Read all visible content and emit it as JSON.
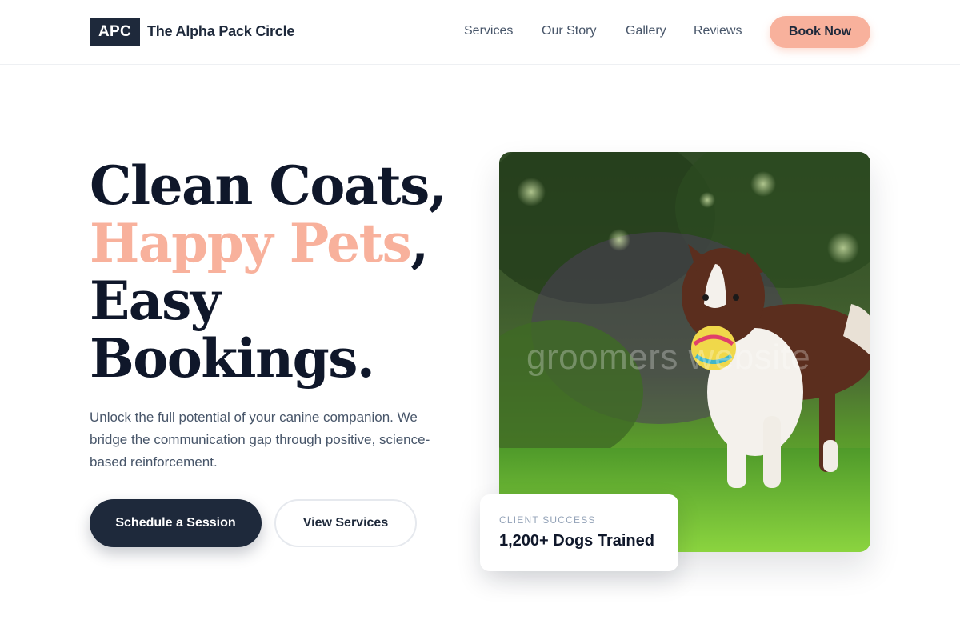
{
  "brand": {
    "badge": "APC",
    "name": "The Alpha Pack Circle"
  },
  "nav": {
    "items": [
      {
        "label": "Services"
      },
      {
        "label": "Our Story"
      },
      {
        "label": "Gallery"
      },
      {
        "label": "Reviews"
      }
    ],
    "cta_label": "Book Now"
  },
  "hero": {
    "headline_line1": "Clean Coats,",
    "headline_accent": "Happy Pets",
    "headline_line2_suffix": ",",
    "headline_line3": "Easy",
    "headline_line4": "Bookings.",
    "description": "Unlock the full potential of your canine companion. We bridge the communication gap through positive, science-based reinforcement.",
    "primary_button": "Schedule a Session",
    "secondary_button": "View Services"
  },
  "photo": {
    "subject": "border collie running with toy ball on grass",
    "watermark": "groomers website"
  },
  "stat": {
    "label": "CLIENT SUCCESS",
    "value": "1,200+ Dogs Trained"
  },
  "colors": {
    "accent": "#f8b19c",
    "dark": "#1e293b",
    "text_muted": "#475569"
  }
}
